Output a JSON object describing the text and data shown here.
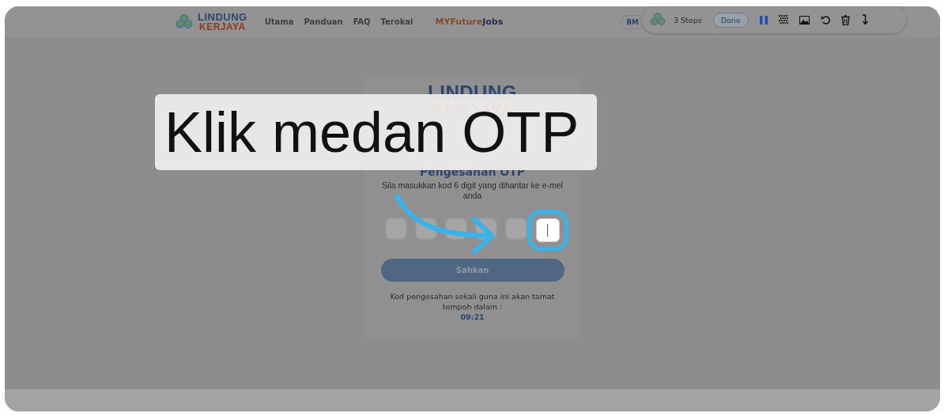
{
  "header": {
    "logo_top": "LINDUNG",
    "logo_bottom": "KERJAYA",
    "nav": [
      "Utama",
      "Panduan",
      "FAQ",
      "Terokai"
    ],
    "partner_logo": {
      "part1": "MYFuture",
      "part2": "Jobs"
    },
    "languages": [
      {
        "label": "BM",
        "selected": true
      }
    ]
  },
  "recorder_toolbar": {
    "steps": "3 Steps",
    "done": "Done"
  },
  "card": {
    "logo_top": "LINDUNG",
    "logo_bottom": "KERJAYA",
    "title": "Pengesahan OTP",
    "instruction": "Sila masukkan kod 6 digit yang dihantar ke e-mel anda",
    "otp_fields": [
      {
        "selected": false
      },
      {
        "selected": false
      },
      {
        "selected": false
      },
      {
        "selected": false
      },
      {
        "selected": false
      },
      {
        "selected": true
      }
    ],
    "submit": "Sahkan",
    "expiry_note": "Kod pengesahan sekali guna ini akan tamat tempoh dalam :",
    "timer": "09:21"
  },
  "callout": {
    "text": "Klik medan OTP"
  }
}
